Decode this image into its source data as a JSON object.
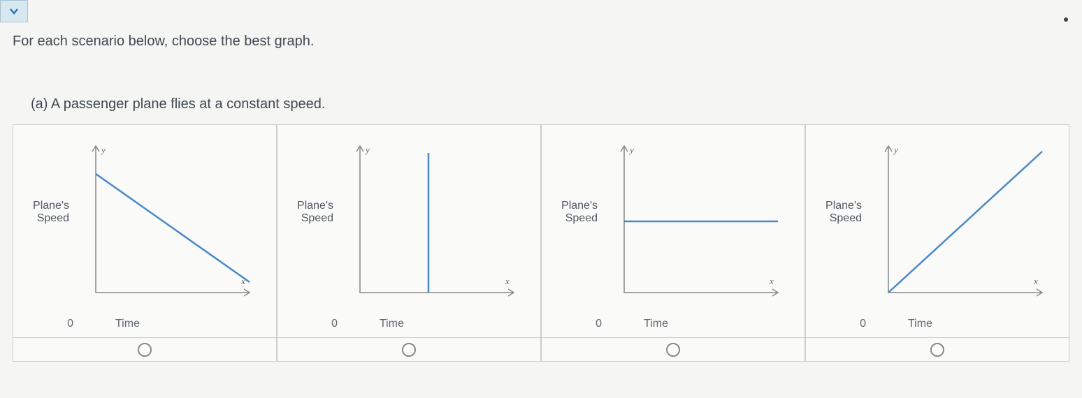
{
  "instruction": "For each scenario below, choose the best graph.",
  "question": {
    "label": "(a) A passenger plane flies at a constant speed.",
    "ylabel_line1": "Plane's",
    "ylabel_line2": "Speed",
    "xlabel": "Time",
    "origin": "0",
    "y_axis_var": "y",
    "x_axis_var": "x"
  },
  "chart_data": [
    {
      "type": "line",
      "xlabel": "Time",
      "ylabel": "Plane's Speed",
      "description": "decreasing linear",
      "x": [
        0,
        10
      ],
      "y": [
        10,
        1
      ]
    },
    {
      "type": "line",
      "xlabel": "Time",
      "ylabel": "Plane's Speed",
      "description": "vertical segment",
      "x": [
        5,
        5
      ],
      "y": [
        0,
        10
      ]
    },
    {
      "type": "line",
      "xlabel": "Time",
      "ylabel": "Plane's Speed",
      "description": "horizontal constant",
      "x": [
        0,
        10
      ],
      "y": [
        6,
        6
      ]
    },
    {
      "type": "line",
      "xlabel": "Time",
      "ylabel": "Plane's Speed",
      "description": "increasing linear from origin",
      "x": [
        0,
        10
      ],
      "y": [
        0,
        10
      ]
    }
  ]
}
